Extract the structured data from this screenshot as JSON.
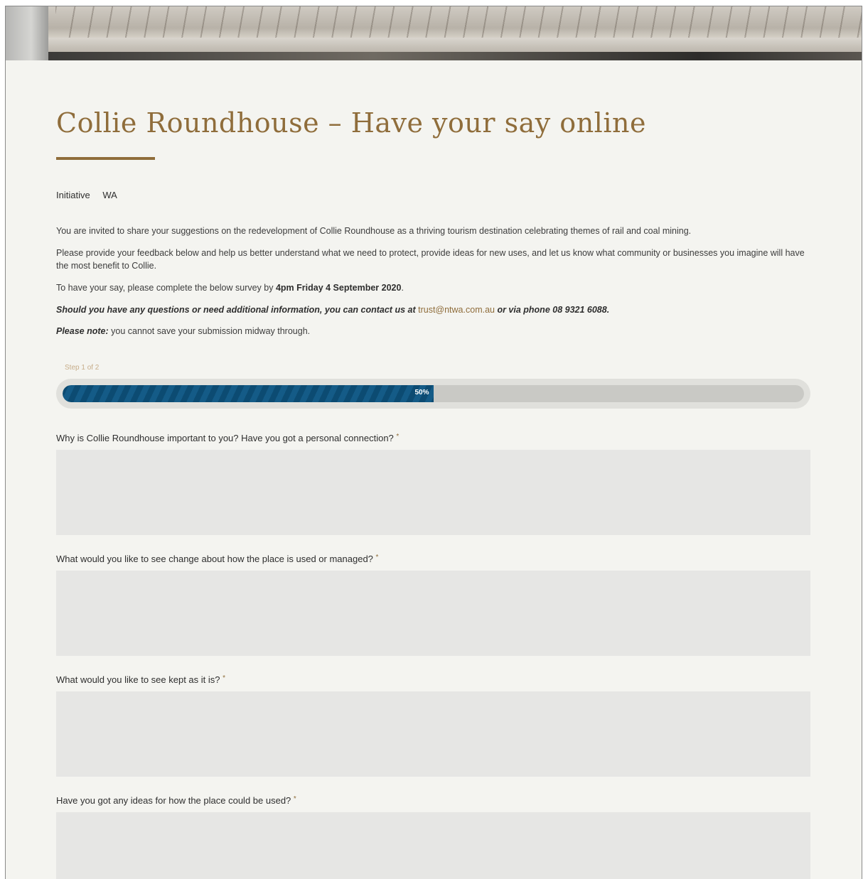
{
  "header": {
    "title": "Collie Roundhouse – Have your say online"
  },
  "meta": {
    "category": "Initiative",
    "region": "WA"
  },
  "intro": {
    "p1": "You are invited to share your suggestions on the redevelopment of Collie Roundhouse as a thriving tourism destination celebrating themes of rail and coal mining.",
    "p2": "Please provide your feedback below and help us better understand what we need to protect, provide ideas for new uses, and let us know what community or businesses you imagine will have the most benefit to Collie.",
    "p3_prefix": "To have your say, please complete the below survey by ",
    "p3_deadline": "4pm Friday 4 September 2020",
    "p3_suffix": ".",
    "p4_prefix": "Should you have any questions or need additional information, you can contact us at ",
    "p4_email": "trust@ntwa.com.au",
    "p4_suffix": " or via phone 08 9321 6088.",
    "p5_label": "Please note:",
    "p5_text": " you cannot save your submission midway through."
  },
  "progress": {
    "step_text": "Step 1 of 2",
    "percent_label": "50%",
    "fraction": 0.5
  },
  "questions": [
    {
      "label": "Why is Collie Roundhouse important to you? Have you got a personal connection?",
      "required_mark": "*"
    },
    {
      "label": "What would you like to see change about how the place is used or managed?",
      "required_mark": "*"
    },
    {
      "label": "What would you like to see kept as it is?",
      "required_mark": "*"
    },
    {
      "label": "Have you got any ideas for how the place could be used?",
      "required_mark": "*"
    }
  ],
  "colors": {
    "accent": "#8f6d3b",
    "progress": "#0c4b72",
    "background": "#f4f4f0",
    "field": "#e6e6e4"
  }
}
